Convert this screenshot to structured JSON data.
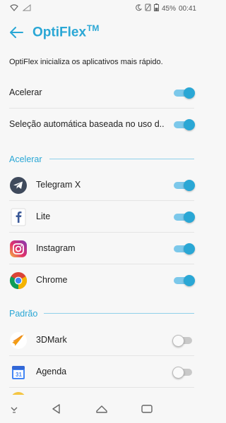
{
  "status_bar": {
    "battery": "45%",
    "time": "00:41"
  },
  "app_bar": {
    "title": "OptiFlex",
    "trademark": "TM"
  },
  "description": "OptiFlex inicializa os aplicativos mais rápido.",
  "settings": [
    {
      "label": "Acelerar",
      "enabled": true
    },
    {
      "label": "Seleção automática baseada no uso d..",
      "enabled": true
    }
  ],
  "sections": [
    {
      "title": "Acelerar",
      "apps": [
        {
          "name": "Telegram X",
          "icon": "telegram-icon",
          "enabled": true
        },
        {
          "name": "Lite",
          "icon": "facebook-lite-icon",
          "enabled": true
        },
        {
          "name": "Instagram",
          "icon": "instagram-icon",
          "enabled": true
        },
        {
          "name": "Chrome",
          "icon": "chrome-icon",
          "enabled": true
        }
      ]
    },
    {
      "title": "Padrão",
      "apps": [
        {
          "name": "3DMark",
          "icon": "3dmark-icon",
          "enabled": false
        },
        {
          "name": "Agenda",
          "icon": "calendar-icon",
          "enabled": false,
          "icon_text": "31"
        }
      ]
    }
  ],
  "colors": {
    "accent": "#2aa7d5",
    "toggle_track_on": "#7cc8ea",
    "toggle_off": "#c9c9c9",
    "background": "#f7f7f7"
  },
  "nav_bar": {
    "icons": [
      "hide-keyboard-icon",
      "back-icon",
      "home-icon",
      "recents-icon"
    ]
  }
}
